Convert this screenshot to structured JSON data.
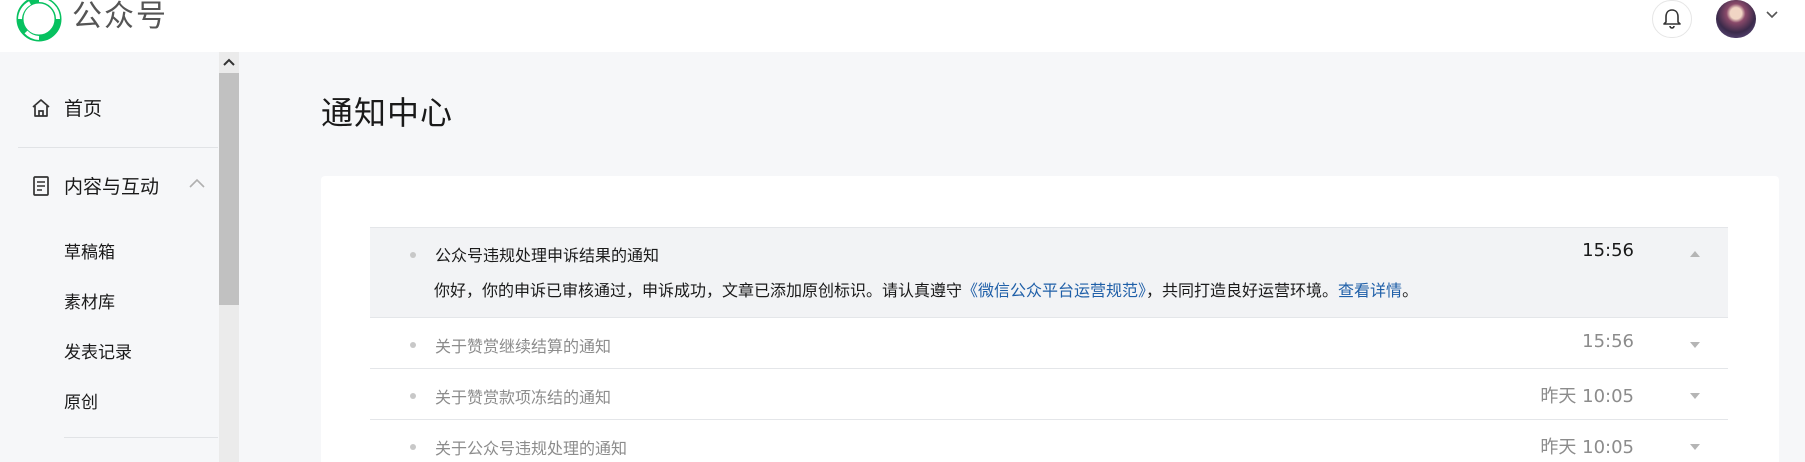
{
  "header": {
    "brand": "公众号",
    "logo_icon": "wechat-official-account-logo",
    "bell_icon": "bell-icon",
    "accent_color": "#07c160"
  },
  "sidebar": {
    "items": [
      {
        "label": "首页",
        "icon": "home-icon"
      },
      {
        "label": "内容与互动",
        "icon": "document-icon",
        "expanded": true
      }
    ],
    "sub_items": [
      "草稿箱",
      "素材库",
      "发表记录",
      "原创"
    ]
  },
  "main": {
    "title": "通知中心",
    "notices": [
      {
        "title": "公众号违规处理申诉结果的通知",
        "time": "15:56",
        "expanded": true,
        "body_prefix": "你好，你的申诉已审核通过，申诉成功，文章已添加原创标识。请认真遵守",
        "body_link1": "《微信公众平台运营规范》",
        "body_mid": "，共同打造良好运营环境。",
        "body_link2": "查看详情",
        "body_suffix": "。"
      },
      {
        "title": "关于赞赏继续结算的通知",
        "time": "15:56",
        "expanded": false
      },
      {
        "title": "关于赞赏款项冻结的通知",
        "time": "昨天 10:05",
        "expanded": false
      },
      {
        "title": "关于公众号违规处理的通知",
        "time": "昨天 10:05",
        "expanded": false
      }
    ]
  },
  "colors": {
    "link": "#1f5fa8",
    "muted_text": "#8c8c8c"
  }
}
